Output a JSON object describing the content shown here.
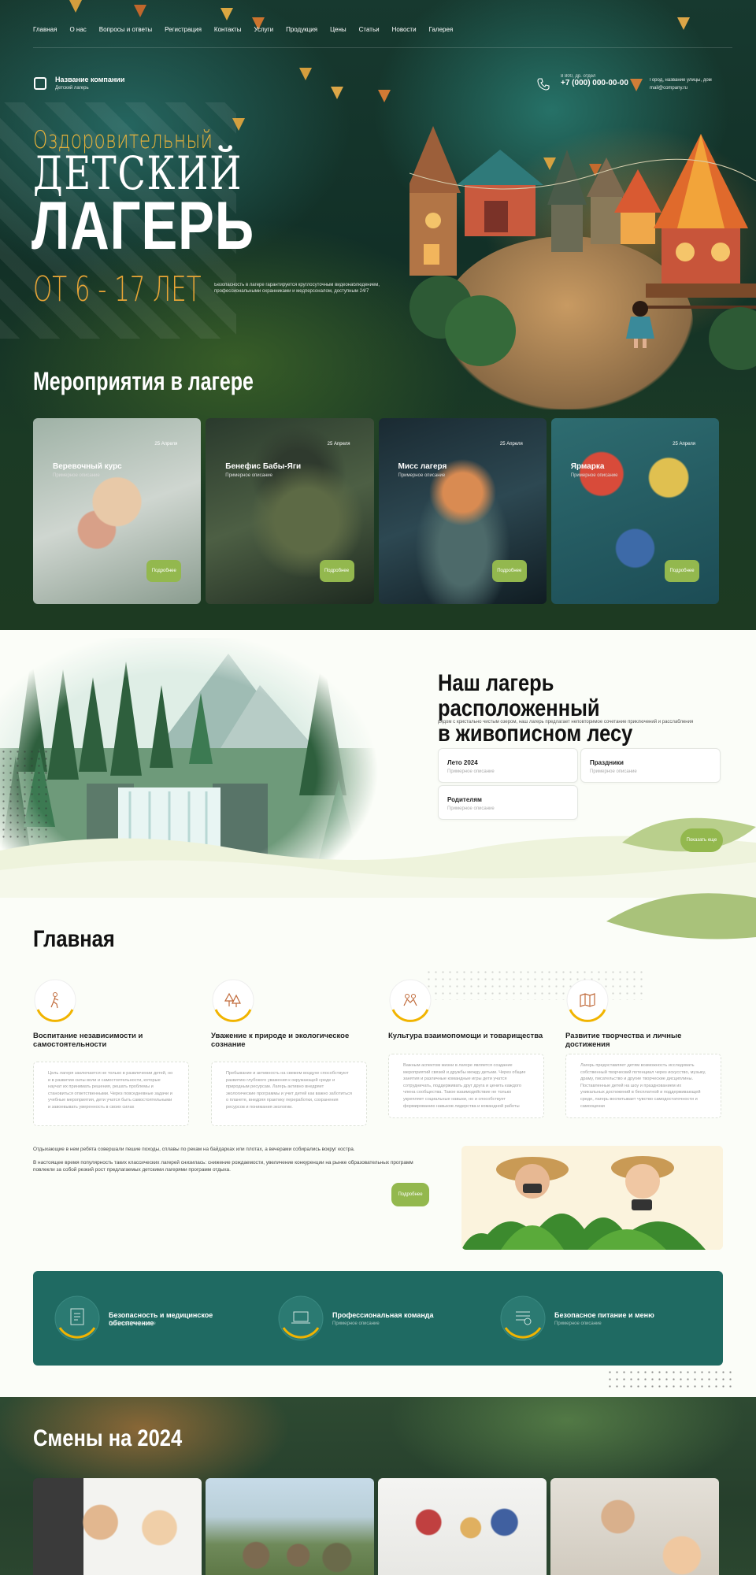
{
  "nav": [
    "Главная",
    "О нас",
    "Вопросы и ответы",
    "Регистрация",
    "Контакты",
    "Услуги",
    "Продукция",
    "Цены",
    "Статьи",
    "Новости",
    "Галерея"
  ],
  "company": {
    "name": "Название компании",
    "subtitle": "Детский лагерь"
  },
  "contact": {
    "phone_label": "8 800, др. отдел",
    "phone": "+7 (000) 000-00-00",
    "address": "Город, название улицы, дом",
    "email": "mail@company.ru"
  },
  "hero": {
    "pre": "Оздоровительный",
    "mid": "ДЕТСКИЙ",
    "big": "ЛАГЕРЬ",
    "age": "ОТ 6 - 17 ЛЕТ",
    "desc": "Безопасность в лагере гарантируется круглосуточным видеонаблюдением, профессиональными охранниками и медперсоналом, доступным 24/7"
  },
  "events": {
    "title": "Мероприятия в лагере",
    "items": [
      {
        "title": "Веревочный курс",
        "subtitle": "Примерное описание",
        "date": "25 Апреля",
        "button": "Подробнее"
      },
      {
        "title": "Бенефис Бабы-Яги",
        "subtitle": "Примерное описание",
        "date": "25 Апреля",
        "button": "Подробнее"
      },
      {
        "title": "Мисс лагеря",
        "subtitle": "Примерное описание",
        "date": "25 Апреля",
        "button": "Подробнее"
      },
      {
        "title": "Ярмарка",
        "subtitle": "Примерное описание",
        "date": "25 Апреля",
        "button": "Подробнее"
      }
    ]
  },
  "forest": {
    "title_line1": "Наш лагерь расположенный",
    "title_line2": "в живописном лесу",
    "desc": "рядом с кристально чистым озером, наш лагерь предлагает неповторимое сочетание приключений и расслабления",
    "boxes": [
      {
        "title": "Лето 2024",
        "subtitle": "Примерное описание"
      },
      {
        "title": "Праздники",
        "subtitle": "Примерное описание"
      },
      {
        "title": "Родителям",
        "subtitle": "Примерное описание"
      }
    ],
    "button": "Показать еще"
  },
  "main": {
    "title": "Главная",
    "features": [
      {
        "title": "Воспитание независимости и самостоятельности",
        "text": "Цель лагеря заключается не только в развлечении детей, но и в развитии силы воли и самостоятельности, которые научат их принимать решения, решать проблемы и становиться ответственными. Через повседневные задачи и учебные мероприятия, дети учатся быть самостоятельными и завоевывать уверенность в своих силах",
        "icon": "hiker-icon"
      },
      {
        "title": "Уважение к природе и экологическое сознание",
        "text": "Пребывание и активность на свежем воздухе способствуют развитию глубокого уважения к окружающей среде и природным ресурсам. Лагерь активно внедряет экологические программы и учит детей как важно заботиться о планете, внедряя практику переработки, сохранения ресурсов и понимания экологии.",
        "icon": "forest-icon"
      },
      {
        "title": "Культура взаимопомощи и товарищества",
        "text": "Важным аспектом жизни в лагере является создание мероприятий связей и дружбы между детьми. Через общие занятия и различные командные игры дети учатся сотрудничать, поддерживать друг друга и ценить каждого члена сообщества. Такое взаимодействие не только укрепляет социальные навыки, но и способствует формированию навыков лидерства и командной работы",
        "icon": "teamwork-icon"
      },
      {
        "title": "Развитие творчества и личные достижения",
        "text": "Лагерь предоставляет детям возможность исследовать собственный творческий потенциал через искусство, музыку, драму, писательство и другие творческие дисциплины. Поставленные детей на шоу и празднованием их уникальных достижений в бесплатной и поддерживающей среде, лагерь воспитывает чувство самодостаточности и самооценки",
        "icon": "map-icon"
      }
    ],
    "p1": "Отдыхающие в нем ребята совершали пешие походы, сплавы по рекам на байдарках или плотах, а вечерами собирались вокруг костра.",
    "p2": "В настоящее время популярность таких классических лагерей снизилась: снижение рождаемости, увеличение конкуренции на рынке образовательных программ повлекли за собой резкий рост предлагаемых детскими лагерями программ отдыха.",
    "button": "Подробнее"
  },
  "band": [
    {
      "title": "Безопасность и медицинское обеспечение",
      "subtitle": "Примерное описание",
      "icon": "medical-doc-icon"
    },
    {
      "title": "Профессиональная команда",
      "subtitle": "Примерное описание",
      "icon": "laptop-icon"
    },
    {
      "title": "Безопасное питание и меню",
      "subtitle": "Примерное описание",
      "icon": "menu-list-icon"
    }
  ],
  "shifts": {
    "title": "Смены на 2024"
  },
  "colors": {
    "accent": "#93b84e",
    "teal": "#1f6a62",
    "gold": "#e8a536"
  }
}
